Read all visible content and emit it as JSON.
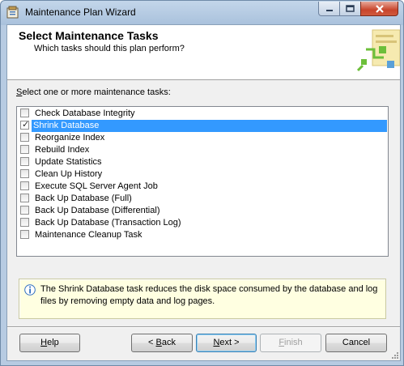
{
  "window": {
    "title": "Maintenance Plan Wizard"
  },
  "header": {
    "title": "Select Maintenance Tasks",
    "subtitle": "Which tasks should this plan perform?"
  },
  "prompt": {
    "pre": "",
    "accel": "S",
    "post": "elect one or more maintenance tasks:"
  },
  "tasks": [
    {
      "label": "Check Database Integrity",
      "checked": false,
      "selected": false
    },
    {
      "label": "Shrink Database",
      "checked": true,
      "selected": true
    },
    {
      "label": "Reorganize Index",
      "checked": false,
      "selected": false
    },
    {
      "label": "Rebuild Index",
      "checked": false,
      "selected": false
    },
    {
      "label": "Update Statistics",
      "checked": false,
      "selected": false
    },
    {
      "label": "Clean Up History",
      "checked": false,
      "selected": false
    },
    {
      "label": "Execute SQL Server Agent Job",
      "checked": false,
      "selected": false
    },
    {
      "label": "Back Up Database (Full)",
      "checked": false,
      "selected": false
    },
    {
      "label": "Back Up Database (Differential)",
      "checked": false,
      "selected": false
    },
    {
      "label": "Back Up Database (Transaction Log)",
      "checked": false,
      "selected": false
    },
    {
      "label": "Maintenance Cleanup Task",
      "checked": false,
      "selected": false
    }
  ],
  "info": {
    "text": "The Shrink Database task reduces the disk space consumed by the database and log files by removing empty data and log pages."
  },
  "buttons": {
    "help": {
      "pre": "",
      "accel": "H",
      "post": "elp"
    },
    "back": {
      "pre": "< ",
      "accel": "B",
      "post": "ack"
    },
    "next": {
      "pre": "",
      "accel": "N",
      "post": "ext >"
    },
    "finish": {
      "pre": "",
      "accel": "F",
      "post": "inish"
    },
    "cancel": {
      "pre": "",
      "accel": "",
      "post": "Cancel"
    }
  },
  "icons": {
    "app": "wizard-app-icon",
    "info": "info-icon",
    "minimize": "minimize-icon",
    "maximize": "maximize-icon",
    "close": "close-icon"
  },
  "colors": {
    "selection": "#3399ff",
    "info_background": "#ffffe1",
    "close_button": "#c8452c"
  }
}
